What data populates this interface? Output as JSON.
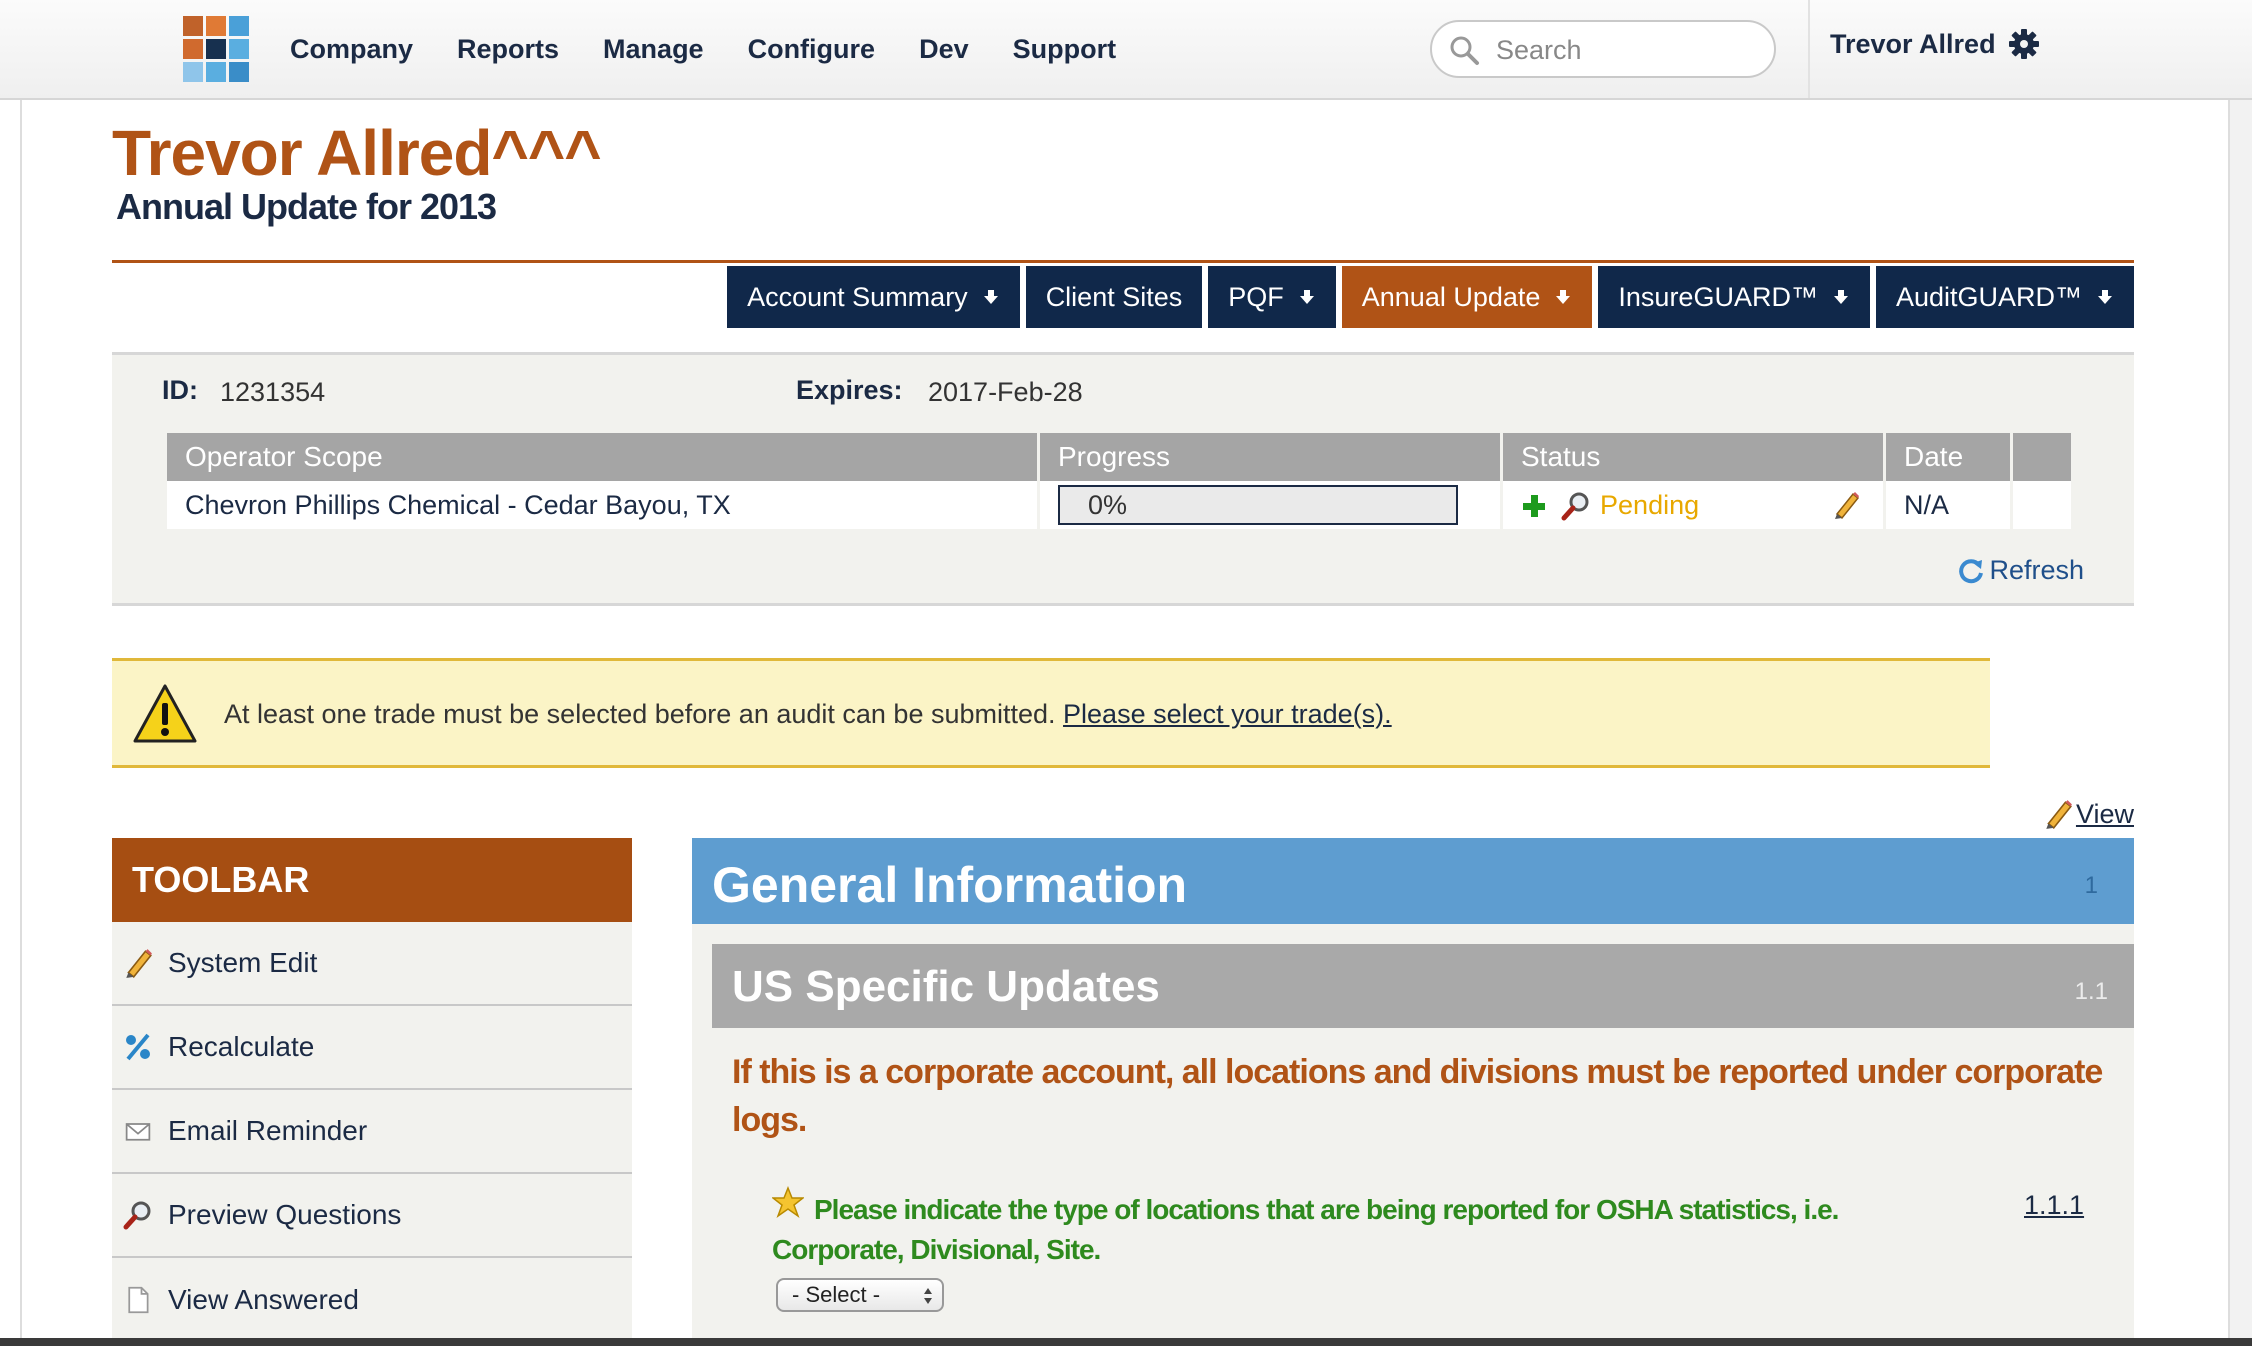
{
  "nav": {
    "items": [
      "Company",
      "Reports",
      "Manage",
      "Configure",
      "Dev",
      "Support"
    ],
    "search_placeholder": "Search",
    "user": "Trevor Allred"
  },
  "header": {
    "title": "Trevor Allred^^^",
    "subtitle": "Annual Update for 2013"
  },
  "tabs": [
    {
      "label": "Account Summary",
      "dropdown": true
    },
    {
      "label": "Client Sites",
      "dropdown": false
    },
    {
      "label": "PQF",
      "dropdown": true
    },
    {
      "label": "Annual Update",
      "dropdown": true,
      "active": true
    },
    {
      "label": "InsureGUARD™",
      "dropdown": true
    },
    {
      "label": "AuditGUARD™",
      "dropdown": true
    }
  ],
  "audit": {
    "id_label": "ID:",
    "id_value": "1231354",
    "expires_label": "Expires:",
    "expires_value": "2017-Feb-28",
    "columns": [
      "Operator Scope",
      "Progress",
      "Status",
      "Date"
    ],
    "row": {
      "operator": "Chevron Phillips Chemical - Cedar Bayou, TX",
      "progress": "0%",
      "status": "Pending",
      "date": "N/A"
    },
    "refresh": "Refresh"
  },
  "warning": {
    "text": "At least one trade must be selected before an audit can be submitted.",
    "link": "Please select your trade(s)."
  },
  "view_link": "View",
  "toolbar": {
    "title": "TOOLBAR",
    "items": [
      "System Edit",
      "Recalculate",
      "Email Reminder",
      "Preview Questions",
      "View Answered"
    ]
  },
  "section": {
    "title": "General Information",
    "number": "1",
    "sub_title": "US Specific Updates",
    "sub_number": "1.1",
    "note": "If this is a corporate account, all locations and divisions must be reported under corporate logs.",
    "question": "Please indicate the type of locations that are being reported for OSHA statistics, i.e. Corporate, Divisional, Site.",
    "question_number": "1.1.1",
    "select_value": "- Select -"
  },
  "colors": {
    "brand_orange": "#b05316",
    "navy": "#10284a",
    "section_blue": "#5e9dd0",
    "pending": "#e8a800",
    "question_green": "#2e8a1e"
  }
}
